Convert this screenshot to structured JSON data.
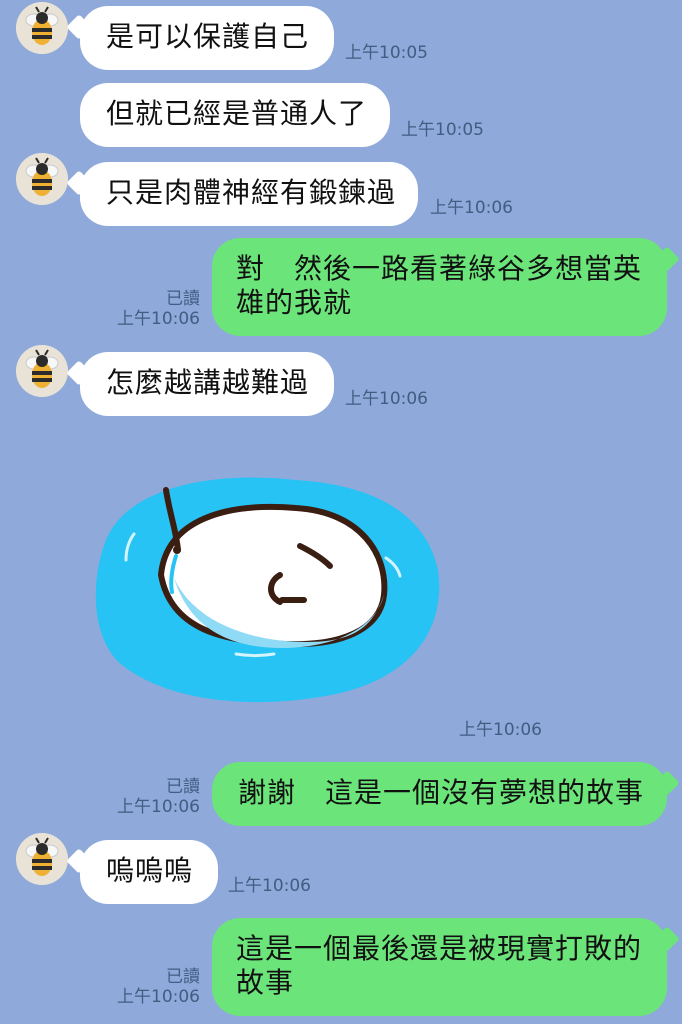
{
  "messages": [
    {
      "text": "是可以保護自己",
      "time": "上午10:05"
    },
    {
      "text": "但就已經是普通人了",
      "time": "上午10:05"
    },
    {
      "text": "只是肉體神經有鍛鍊過",
      "time": "上午10:06"
    },
    {
      "text": "對　然後一路看著綠谷多想當英雄的我就",
      "time": "上午10:06",
      "read": "已讀"
    },
    {
      "text": "怎麼越講越難過",
      "time": "上午10:06"
    },
    {
      "time": "上午10:06"
    },
    {
      "text": "謝謝　這是一個沒有夢想的故事",
      "time": "上午10:06",
      "read": "已讀"
    },
    {
      "text": "嗚嗚嗚",
      "time": "上午10:06"
    },
    {
      "text": "這是一個最後還是被現實打敗的故事",
      "time": "上午10:06",
      "read": "已讀"
    }
  ],
  "colors": {
    "background": "#8fa9da",
    "incoming_bubble": "#ffffff",
    "outgoing_bubble": "#6be47a",
    "meta_text": "#435c82"
  },
  "icons": {
    "avatar": "bee-icon",
    "sticker": "crying-bird-sticker"
  }
}
